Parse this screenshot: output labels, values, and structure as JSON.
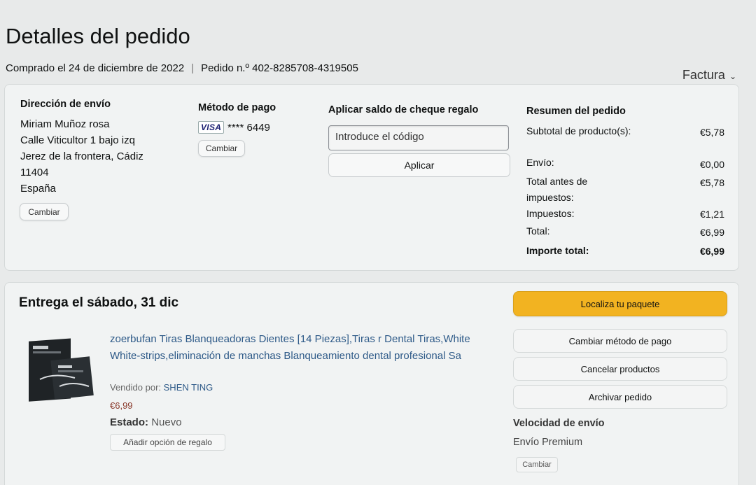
{
  "page": {
    "title": "Detalles del pedido",
    "purchase_date": "Comprado el 24 de diciembre de 2022",
    "separator": "|",
    "order_number": "Pedido n.º 402-8285708-4319505",
    "invoice_label": "Factura",
    "invoice_icon": "chevron-down-icon"
  },
  "shipping": {
    "heading": "Dirección de envío",
    "lines": [
      "Miriam Muñoz rosa",
      "Calle Viticultor 1 bajo izq",
      "Jerez de la frontera, Cádiz",
      "11404",
      "España"
    ],
    "change_label": "Cambiar"
  },
  "payment": {
    "heading": "Método de pago",
    "card_brand": "VISA",
    "card_number": "**** 6449",
    "change_label": "Cambiar"
  },
  "gift_card": {
    "heading": "Aplicar saldo de cheque regalo",
    "placeholder": "Introduce el código",
    "apply_label": "Aplicar"
  },
  "summary": {
    "heading": "Resumen del pedido",
    "rows": [
      {
        "label": "Subtotal de producto(s):",
        "value": "€5,78"
      },
      {
        "label": "Envío:",
        "value": "€0,00"
      },
      {
        "label": "Total antes de impuestos:",
        "value": "€5,78"
      },
      {
        "label": "Impuestos:",
        "value": "€1,21"
      },
      {
        "label": "Total:",
        "value": "€6,99"
      },
      {
        "label": "Importe total:",
        "value": "€6,99"
      }
    ]
  },
  "shipment": {
    "title": "Entrega el sábado, 31 dic",
    "product_title": "zoerbufan Tiras Blanqueadoras Dientes [14 Piezas],Tiras r Dental Tiras,White White-strips,eliminación de manchas Blanqueamiento dental profesional Sa",
    "sold_by_label": "Vendido por:",
    "seller": "SHEN TING",
    "price": "€6,99",
    "condition_label": "Estado:",
    "condition_value": "Nuevo",
    "gift_option_label": "Añadir opción de regalo",
    "track_label": "Localiza tu paquete",
    "change_payment_label": "Cambiar método de pago",
    "cancel_label": "Cancelar productos",
    "archive_label": "Archivar pedido",
    "speed_heading": "Velocidad de envío",
    "speed_value": "Envío Premium",
    "speed_change_label": "Cambiar"
  },
  "colors": {
    "accent_button": "#f2b321",
    "link": "#2e5a88",
    "price": "#8a3a2c"
  }
}
